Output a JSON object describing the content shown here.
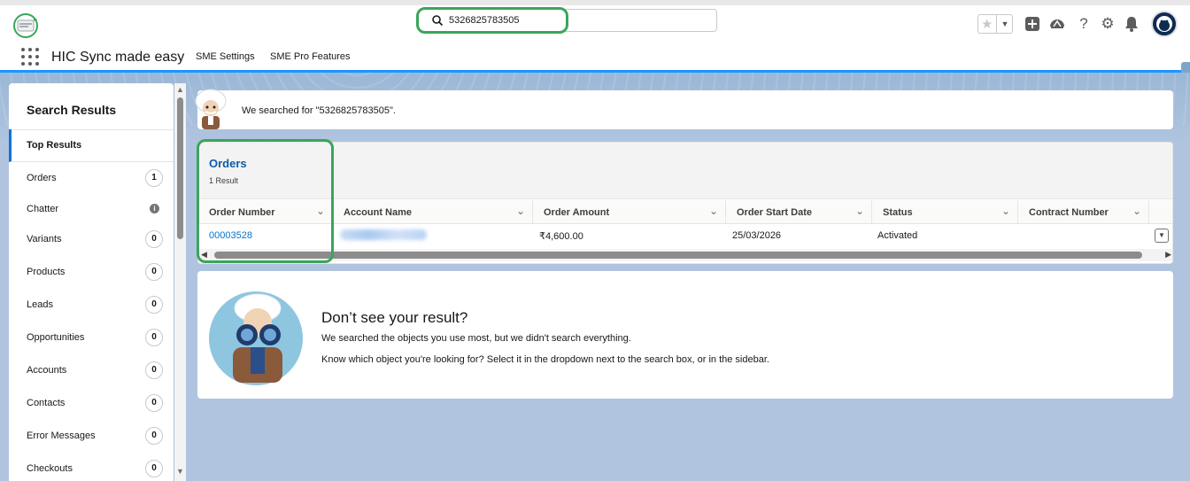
{
  "header": {
    "search_value": "5326825783505",
    "app_name": "HIC Sync made easy",
    "nav_items": [
      "SME Settings",
      "SME Pro Features"
    ]
  },
  "sidebar": {
    "title": "Search Results",
    "top_results": "Top Results",
    "items": [
      {
        "label": "Orders",
        "count": "1"
      },
      {
        "label": "Chatter",
        "count": ""
      },
      {
        "label": "Variants",
        "count": "0"
      },
      {
        "label": "Products",
        "count": "0"
      },
      {
        "label": "Leads",
        "count": "0"
      },
      {
        "label": "Opportunities",
        "count": "0"
      },
      {
        "label": "Accounts",
        "count": "0"
      },
      {
        "label": "Contacts",
        "count": "0"
      },
      {
        "label": "Error Messages",
        "count": "0"
      },
      {
        "label": "Checkouts",
        "count": "0"
      }
    ]
  },
  "notice": {
    "text": "We searched for \"5326825783505\"."
  },
  "orders": {
    "title": "Orders",
    "count": "1 Result",
    "columns": [
      "Order Number",
      "Account Name",
      "Order Amount",
      "Order Start Date",
      "Status",
      "Contract Number"
    ],
    "row": {
      "order_number": "00003528",
      "order_amount": "₹4,600.00",
      "order_start_date": "25/03/2026",
      "status": "Activated"
    }
  },
  "no_result": {
    "title": "Don’t see your result?",
    "line1": "We searched the objects you use most, but we didn't search everything.",
    "line2": "Know which object you're looking for? Select it in the dropdown next to the search box, or in the sidebar."
  },
  "colors": {
    "accent": "#0176d3",
    "highlight": "#3aa55a",
    "background": "#b0c4df"
  }
}
